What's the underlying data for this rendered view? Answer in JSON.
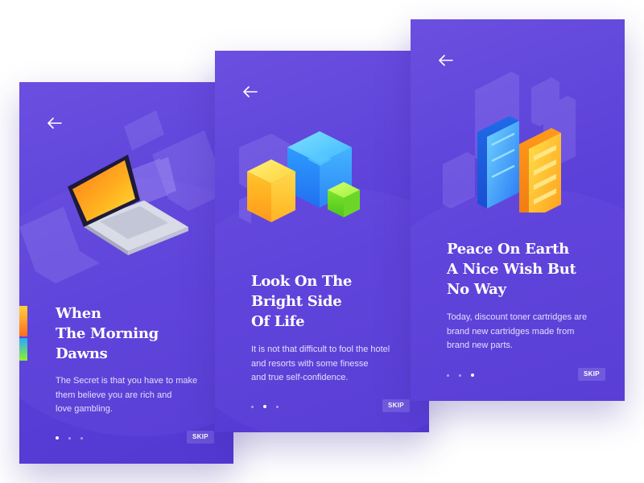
{
  "cards": [
    {
      "title_lines": [
        "When",
        "The Morning",
        "Dawns"
      ],
      "description_lines": [
        "The Secret is that you have to make",
        "them believe you are rich and",
        "love gambling."
      ],
      "skip_label": "SKIP",
      "active_dot": 1,
      "illustration": "laptop-icon"
    },
    {
      "title_lines": [
        "Look On The",
        "Bright Side",
        "Of Life"
      ],
      "description_lines": [
        "It is not that difficult to fool the hotel",
        "and resorts with some finesse",
        "and true self-confidence."
      ],
      "skip_label": "SKIP",
      "active_dot": 2,
      "illustration": "cubes-icon"
    },
    {
      "title_lines": [
        "Peace On Earth",
        "A Nice Wish But",
        "No Way"
      ],
      "description_lines": [
        "Today, discount toner cartridges are",
        "brand new cartridges made from",
        "brand new parts."
      ],
      "skip_label": "SKIP",
      "active_dot": 3,
      "illustration": "cards-stack-icon"
    }
  ],
  "colors": {
    "card_background": "#5a3fd8",
    "title_text": "#ffffff",
    "body_text": "#e4defc",
    "accent_yellow": "#ffd23a",
    "accent_orange": "#ff8a1e",
    "accent_blue": "#2aa8ff",
    "accent_green": "#8cf32a"
  },
  "icons": {
    "back": "arrow-left-icon"
  }
}
